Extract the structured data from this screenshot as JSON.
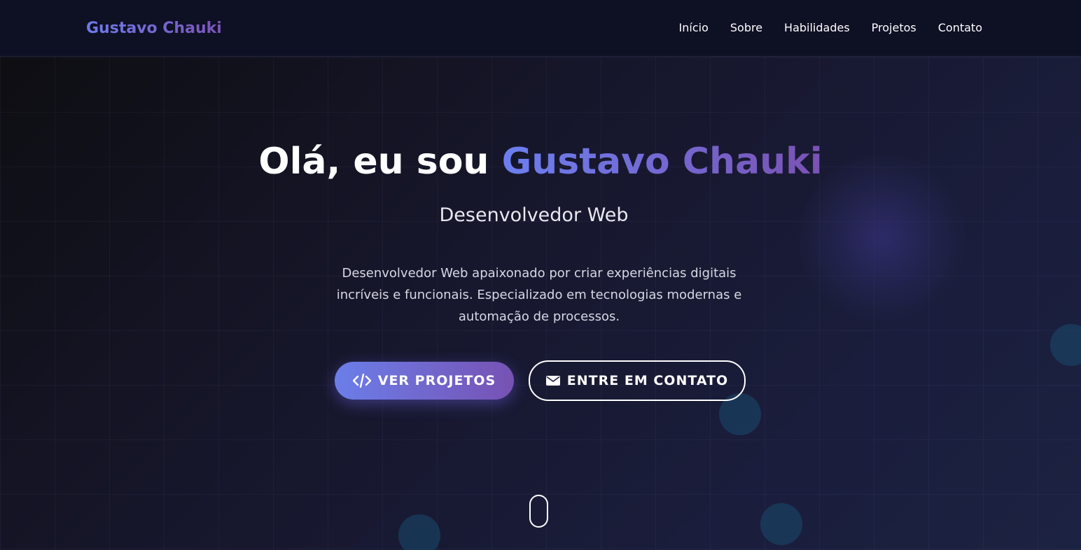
{
  "nav": {
    "brand": "Gustavo Chauki",
    "items": [
      {
        "label": "Início"
      },
      {
        "label": "Sobre"
      },
      {
        "label": "Habilidades"
      },
      {
        "label": "Projetos"
      },
      {
        "label": "Contato"
      }
    ]
  },
  "hero": {
    "title_prefix": "Olá, eu sou ",
    "title_name": "Gustavo Chauki",
    "subtitle": "Desenvolvedor Web",
    "description": "Desenvolvedor Web apaixonado por criar experiências digitais incríveis e funcionais. Especializado em tecnologias modernas e automação de processos.",
    "buttons": {
      "primary": {
        "label": "VER PROJETOS",
        "icon": "code-icon"
      },
      "secondary": {
        "label": "ENTRE EM CONTATO",
        "icon": "envelope-icon"
      }
    }
  },
  "colors": {
    "accent_start": "#6b7ee9",
    "accent_end": "#7752b3",
    "nav_background": "#0e1024"
  }
}
